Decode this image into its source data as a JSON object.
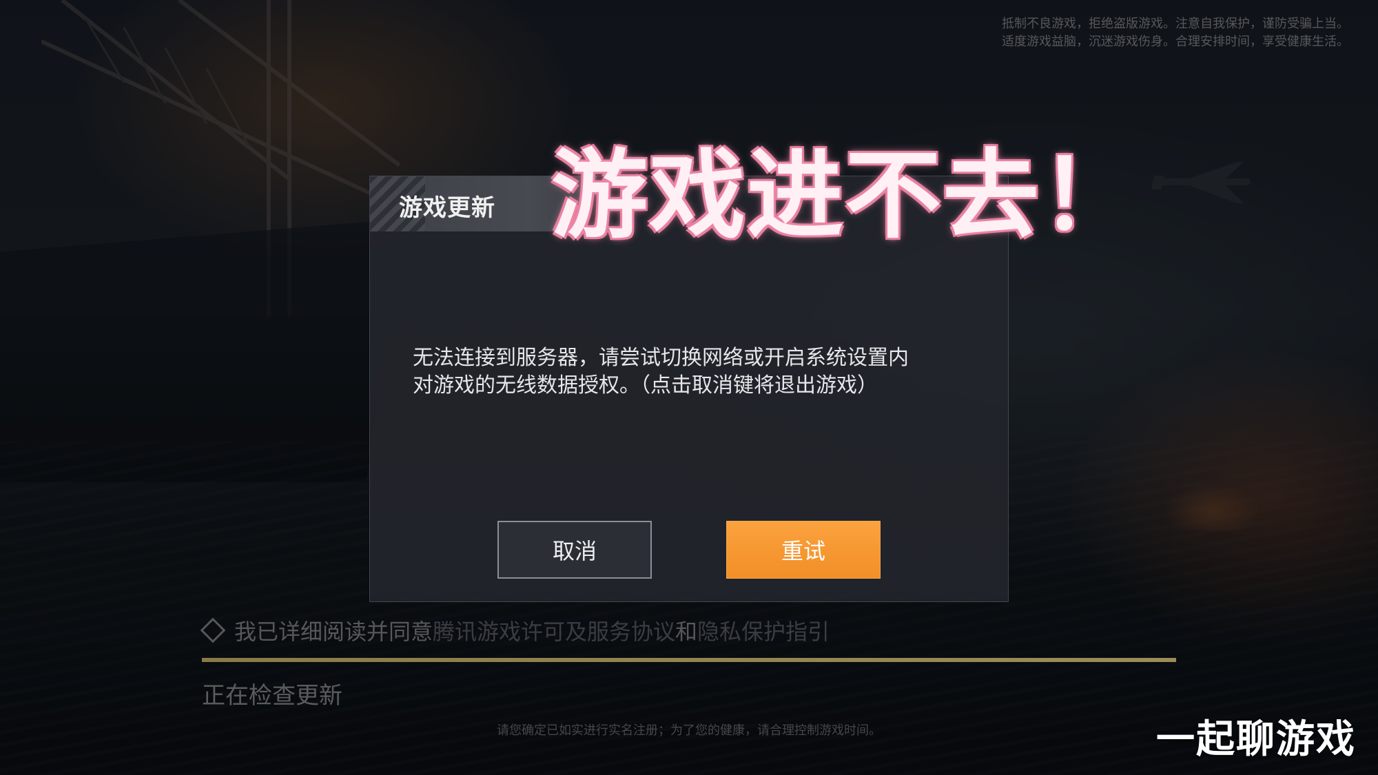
{
  "notice_top": {
    "line1": "抵制不良游戏，拒绝盗版游戏。注意自我保护，谨防受骗上当。",
    "line2": "适度游戏益脑，沉迷游戏伤身。合理安排时间，享受健康生活。"
  },
  "dialog": {
    "title": "游戏更新",
    "message_line1": "无法连接到服务器，请尝试切换网络或开启系统设置内",
    "message_line2": "对游戏的无线数据授权。（点击取消键将退出游戏）",
    "cancel_label": "取消",
    "retry_label": "重试",
    "retry_color": "#F39A32"
  },
  "caption": "游戏进不去！",
  "agreement": {
    "prefix": "我已详细阅读并同意",
    "link1": "腾讯游戏许可及服务协议",
    "connector": "和",
    "link2": "隐私保护指引"
  },
  "progress": {
    "fraction": 1.0
  },
  "status_text": "正在检查更新",
  "notice_bottom": "请您确定已如实进行实名注册；为了您的健康，请合理控制游戏时间。",
  "watermark": "一起聊游戏"
}
